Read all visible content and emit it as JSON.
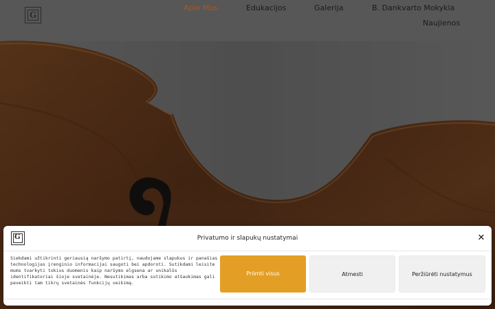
{
  "header": {
    "nav": [
      {
        "label": "Apie Mus",
        "active": true
      },
      {
        "label": "Edukacijos",
        "active": false
      },
      {
        "label": "Galerija",
        "active": false
      },
      {
        "label": "B. Dankvarto Mokykla",
        "active": false
      },
      {
        "label": "Naujienos",
        "active": false
      }
    ],
    "logo_letter": "G"
  },
  "colors": {
    "accent": "#e39f25",
    "active_nav": "#a45a23",
    "wood": "#7a3e17",
    "background": "#4a4a4a"
  },
  "cookie": {
    "logo_letter": "G",
    "title": "Privatumo ir slapukų nustatymai",
    "close_icon": "close-icon",
    "text": "Siekdami užtikrinti geriausią naršymo patirtį, naudojame slapukus ir panašias technologijas įrenginio informacijai saugoti bei apdoroti. Sutikdami leisite mums tvarkyti tokius duomenis kaip naršymo elgsena ar unikalūs identifikatoriai šioje svetainėje. Nesutikimas arba sutikimo atšaukimas gali paveikti tam tikrų svetainės funkcijų veikimą.",
    "accept_label": "Priimti visus",
    "deny_label": "Atmesti",
    "prefs_label": "Peržiūrėti nustatymus"
  }
}
